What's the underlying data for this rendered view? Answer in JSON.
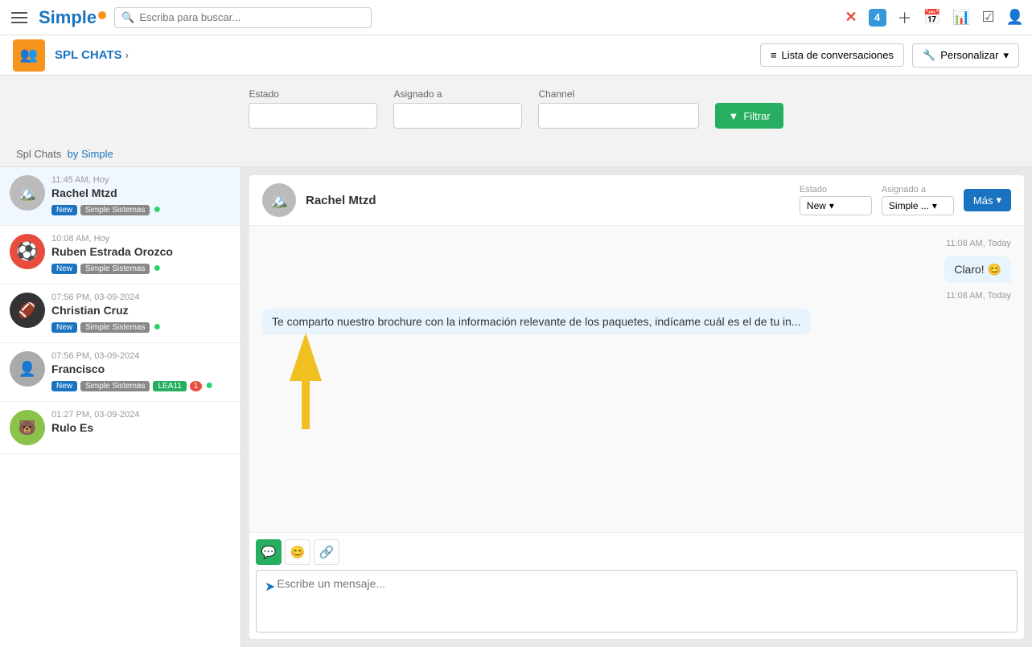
{
  "topNav": {
    "logoText": "Simple",
    "searchPlaceholder": "Escriba para buscar...",
    "icons": [
      "✕",
      "4",
      "+",
      "📅",
      "📊",
      "✔",
      "👤"
    ]
  },
  "subNav": {
    "moduleTitle": "SPL CHATS",
    "chevron": "›",
    "listBtn": "Lista de conversaciones",
    "personalizeBtn": "Personalizar"
  },
  "filterBar": {
    "estadoLabel": "Estado",
    "asignadoLabel": "Asignado a",
    "channelLabel": "Channel",
    "filterBtn": "Filtrar"
  },
  "breadcrumb": {
    "part1": "Spl Chats",
    "part2": "by Simple"
  },
  "chatList": [
    {
      "time": "11:45 AM, Hoy",
      "name": "Rachel Mtzd",
      "tags": [
        "New",
        "Simple Sistemas"
      ],
      "whatsapp": true,
      "avatar": "🏔️"
    },
    {
      "time": "10:08 AM, Hoy",
      "name": "Ruben Estrada Orozco",
      "tags": [
        "New",
        "Simple Sistemas"
      ],
      "whatsapp": true,
      "avatar": "⚽"
    },
    {
      "time": "07:56 PM, 03-09-2024",
      "name": "Christian Cruz",
      "tags": [
        "New",
        "Simple Sistemas"
      ],
      "whatsapp": true,
      "avatar": "🏈"
    },
    {
      "time": "07:56 PM, 03-09-2024",
      "name": "Francisco",
      "tags": [
        "New",
        "Simple Sistemas",
        "LEA11"
      ],
      "count": "1",
      "whatsapp": true,
      "avatar": "👤"
    },
    {
      "time": "01:27 PM, 03-09-2024",
      "name": "Rulo Es",
      "tags": [],
      "whatsapp": false,
      "avatar": "🐻"
    }
  ],
  "chatPanel": {
    "contactName": "Rachel Mtzd",
    "avatar": "🏔️",
    "estadoLabel": "Estado",
    "asignadoLabel": "Asignado a",
    "estadoValue": "New",
    "asignadoValue": "Simple ...",
    "masBtn": "Más",
    "messages": [
      {
        "time": "11:08 AM, Today",
        "text": "Claro! 😊",
        "side": "right"
      },
      {
        "time": "11:08 AM, Today",
        "text": "Te comparto nuestro brochure con la información relevante de los paquetes, indícame cuál es el de tu in...",
        "side": "left"
      }
    ],
    "inputPlaceholder": "Escribe un mensaje...",
    "toolbarBtns": [
      "💬",
      "😊",
      "🔗"
    ]
  }
}
